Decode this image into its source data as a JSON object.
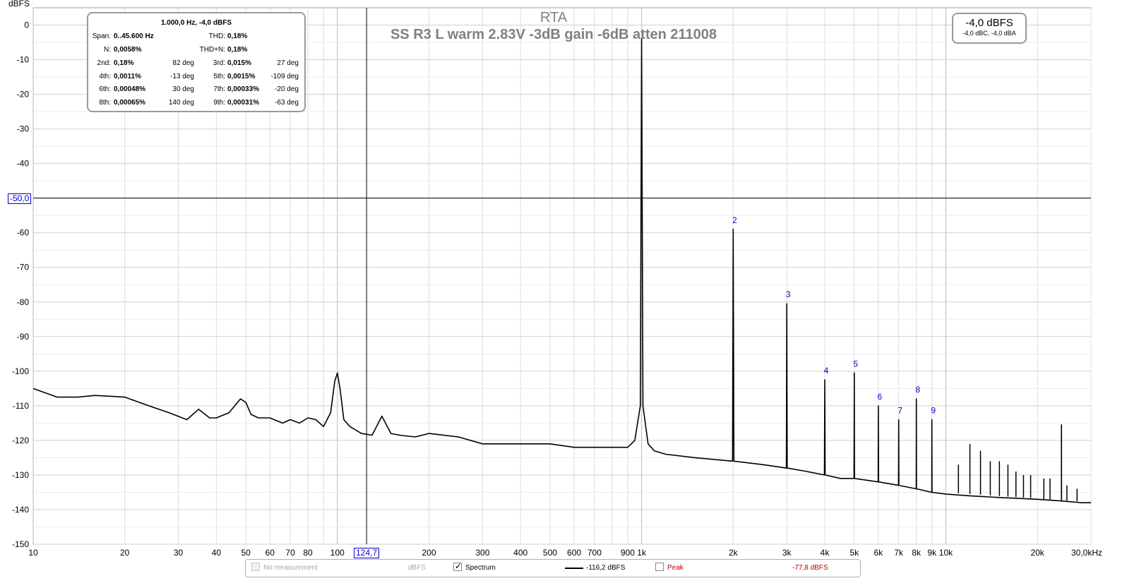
{
  "chart_data": {
    "type": "line",
    "title": "RTA",
    "subtitle": "SS R3 L warm 2.83V -3dB gain -6dB atten 211008",
    "ylabel": "dBFS",
    "x_scale": "log",
    "xlim": [
      10,
      30000
    ],
    "ylim": [
      -150,
      5
    ],
    "x_ticks": [
      {
        "value": 10,
        "label": "10"
      },
      {
        "value": 20,
        "label": "20"
      },
      {
        "value": 30,
        "label": "30"
      },
      {
        "value": 40,
        "label": "40"
      },
      {
        "value": 50,
        "label": "50"
      },
      {
        "value": 60,
        "label": "60"
      },
      {
        "value": 70,
        "label": "70"
      },
      {
        "value": 80,
        "label": "80"
      },
      {
        "value": 100,
        "label": "100"
      },
      {
        "value": 200,
        "label": "200"
      },
      {
        "value": 300,
        "label": "300"
      },
      {
        "value": 400,
        "label": "400"
      },
      {
        "value": 500,
        "label": "500"
      },
      {
        "value": 600,
        "label": "600"
      },
      {
        "value": 700,
        "label": "700"
      },
      {
        "value": 900,
        "label": "900"
      },
      {
        "value": 1000,
        "label": "1k"
      },
      {
        "value": 2000,
        "label": "2k"
      },
      {
        "value": 3000,
        "label": "3k"
      },
      {
        "value": 4000,
        "label": "4k"
      },
      {
        "value": 5000,
        "label": "5k"
      },
      {
        "value": 6000,
        "label": "6k"
      },
      {
        "value": 7000,
        "label": "7k"
      },
      {
        "value": 8000,
        "label": "8k"
      },
      {
        "value": 9000,
        "label": "9k"
      },
      {
        "value": 10000,
        "label": "10k"
      },
      {
        "value": 20000,
        "label": "20k"
      },
      {
        "value": 30000,
        "label": "30,0kHz"
      }
    ],
    "y_ticks": [
      0,
      -10,
      -20,
      -30,
      -40,
      -60,
      -70,
      -80,
      -90,
      -100,
      -110,
      -120,
      -130,
      -140,
      -150
    ],
    "grid": true,
    "series": [
      {
        "name": "Spectrum",
        "color": "#000000",
        "x": [
          10,
          12,
          14,
          16,
          20,
          24,
          28,
          32,
          35,
          38,
          40,
          44,
          48,
          50,
          52,
          55,
          60,
          66,
          70,
          75,
          80,
          85,
          90,
          95,
          98,
          100,
          102,
          105,
          110,
          120,
          130,
          140,
          150,
          160,
          180,
          200,
          250,
          300,
          400,
          500,
          600,
          700,
          800,
          900,
          950,
          990,
          1000,
          1010,
          1050,
          1100,
          1200,
          1500,
          1990,
          2000,
          2010,
          2500,
          2990,
          3000,
          3010,
          3500,
          3990,
          4000,
          4010,
          4500,
          4990,
          5000,
          5010,
          5500,
          5990,
          6000,
          6010,
          6500,
          6990,
          7000,
          7010,
          7500,
          7990,
          8000,
          8010,
          8500,
          8990,
          9000,
          9010,
          10000,
          12000,
          15000,
          20000,
          23990,
          24000,
          24010,
          28000,
          30000
        ],
        "y": [
          -105,
          -107.5,
          -107.5,
          -107,
          -107.5,
          -110,
          -112,
          -114,
          -111,
          -113.5,
          -113.5,
          -112,
          -108,
          -109,
          -112.5,
          -113.5,
          -113.5,
          -115,
          -114,
          -115,
          -113.5,
          -114,
          -116,
          -112,
          -103,
          -100.5,
          -105,
          -114,
          -116,
          -118,
          -118.5,
          -113,
          -118,
          -118.5,
          -119,
          -118,
          -119,
          -121,
          -121,
          -121,
          -122,
          -122,
          -122,
          -122,
          -120,
          -110,
          -4,
          -110,
          -121,
          -123,
          -124,
          -125,
          -126,
          -59,
          -126,
          -127,
          -128,
          -80.5,
          -128,
          -129,
          -130,
          -102.5,
          -130,
          -131,
          -131,
          -100.5,
          -131,
          -131.5,
          -132,
          -110,
          -132,
          -132.5,
          -133,
          -114,
          -133,
          -133.5,
          -134,
          -108,
          -134,
          -134.5,
          -135,
          -114,
          -135,
          -135.5,
          -136,
          -136.5,
          -137,
          -137.5,
          -115.5,
          -137.5,
          -138,
          -138
        ]
      }
    ],
    "harmonics": [
      {
        "label": "2",
        "x": 2000,
        "y": -59
      },
      {
        "label": "3",
        "x": 3000,
        "y": -80.5
      },
      {
        "label": "4",
        "x": 4000,
        "y": -102.5
      },
      {
        "label": "5",
        "x": 5000,
        "y": -100.5
      },
      {
        "label": "6",
        "x": 6000,
        "y": -110
      },
      {
        "label": "7",
        "x": 7000,
        "y": -114
      },
      {
        "label": "8",
        "x": 8000,
        "y": -108
      },
      {
        "label": "9",
        "x": 9000,
        "y": -114
      }
    ],
    "extra_spurs": [
      {
        "x": 11000,
        "y": -127
      },
      {
        "x": 12000,
        "y": -121
      },
      {
        "x": 13000,
        "y": -123
      },
      {
        "x": 14000,
        "y": -126
      },
      {
        "x": 15000,
        "y": -126
      },
      {
        "x": 16000,
        "y": -127
      },
      {
        "x": 17000,
        "y": -129
      },
      {
        "x": 18000,
        "y": -130
      },
      {
        "x": 19000,
        "y": -130
      },
      {
        "x": 21000,
        "y": -131
      },
      {
        "x": 22000,
        "y": -131
      },
      {
        "x": 25000,
        "y": -133
      },
      {
        "x": 27000,
        "y": -134
      }
    ],
    "cursor": {
      "x": 124.7,
      "y": -50.0,
      "x_label": "124,7",
      "y_label": "-50,0"
    }
  },
  "distortion_box": {
    "header": "1.000,0 Hz, -4,0 dBFS",
    "span_label": "Span:",
    "span_value": "0..45.600 Hz",
    "thd_label": "THD:",
    "thd_value": "0,18%",
    "n_label": "N:",
    "n_value": "0,0058%",
    "thdn_label": "THD+N:",
    "thdn_value": "0,18%",
    "rows": [
      {
        "a_label": "2nd:",
        "a_val": "0,18%",
        "a_deg": "82 deg",
        "b_label": "3rd:",
        "b_val": "0,015%",
        "b_deg": "27 deg"
      },
      {
        "a_label": "4th:",
        "a_val": "0,0011%",
        "a_deg": "-13 deg",
        "b_label": "5th:",
        "b_val": "0,0015%",
        "b_deg": "-109 deg"
      },
      {
        "a_label": "6th:",
        "a_val": "0,00048%",
        "a_deg": "30 deg",
        "b_label": "7th:",
        "b_val": "0,00033%",
        "b_deg": "-20 deg"
      },
      {
        "a_label": "8th:",
        "a_val": "0,00065%",
        "a_deg": "140 deg",
        "b_label": "9th:",
        "b_val": "0,00031%",
        "b_deg": "-63 deg"
      }
    ]
  },
  "level_box": {
    "main": "-4,0 dBFS",
    "sub": "-4,0 dBC, -4,0 dBA"
  },
  "legend": {
    "no_measurement": "No measurement",
    "no_measurement_unit": "dBFS",
    "spectrum_label": "Spectrum",
    "spectrum_value": "-116,2 dBFS",
    "peak_label": "Peak",
    "peak_value": "-77,8 dBFS",
    "peak_color": "#c00000"
  }
}
